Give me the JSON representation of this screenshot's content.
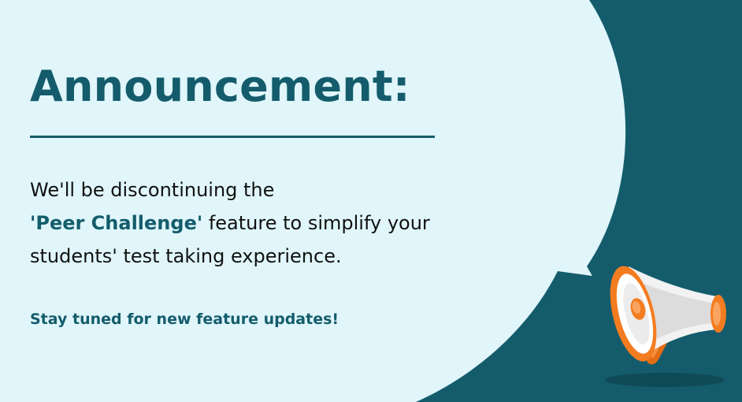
{
  "announcement": {
    "title": "Announcement:",
    "message_line1": "We'll be discontinuing the",
    "message_highlight": "'Peer Challenge'",
    "message_line2_rest": " feature to simplify your",
    "message_line3": "students' test taking experience.",
    "tagline": "Stay tuned for new feature updates!"
  },
  "colors": {
    "background": "#145c6c",
    "bubble": "#e0f6fa",
    "accent_text": "#145c6c",
    "body_text": "#111111",
    "megaphone_orange": "#f47c20",
    "megaphone_white": "#f2f2f2"
  },
  "icons": {
    "illustration": "megaphone-icon"
  }
}
